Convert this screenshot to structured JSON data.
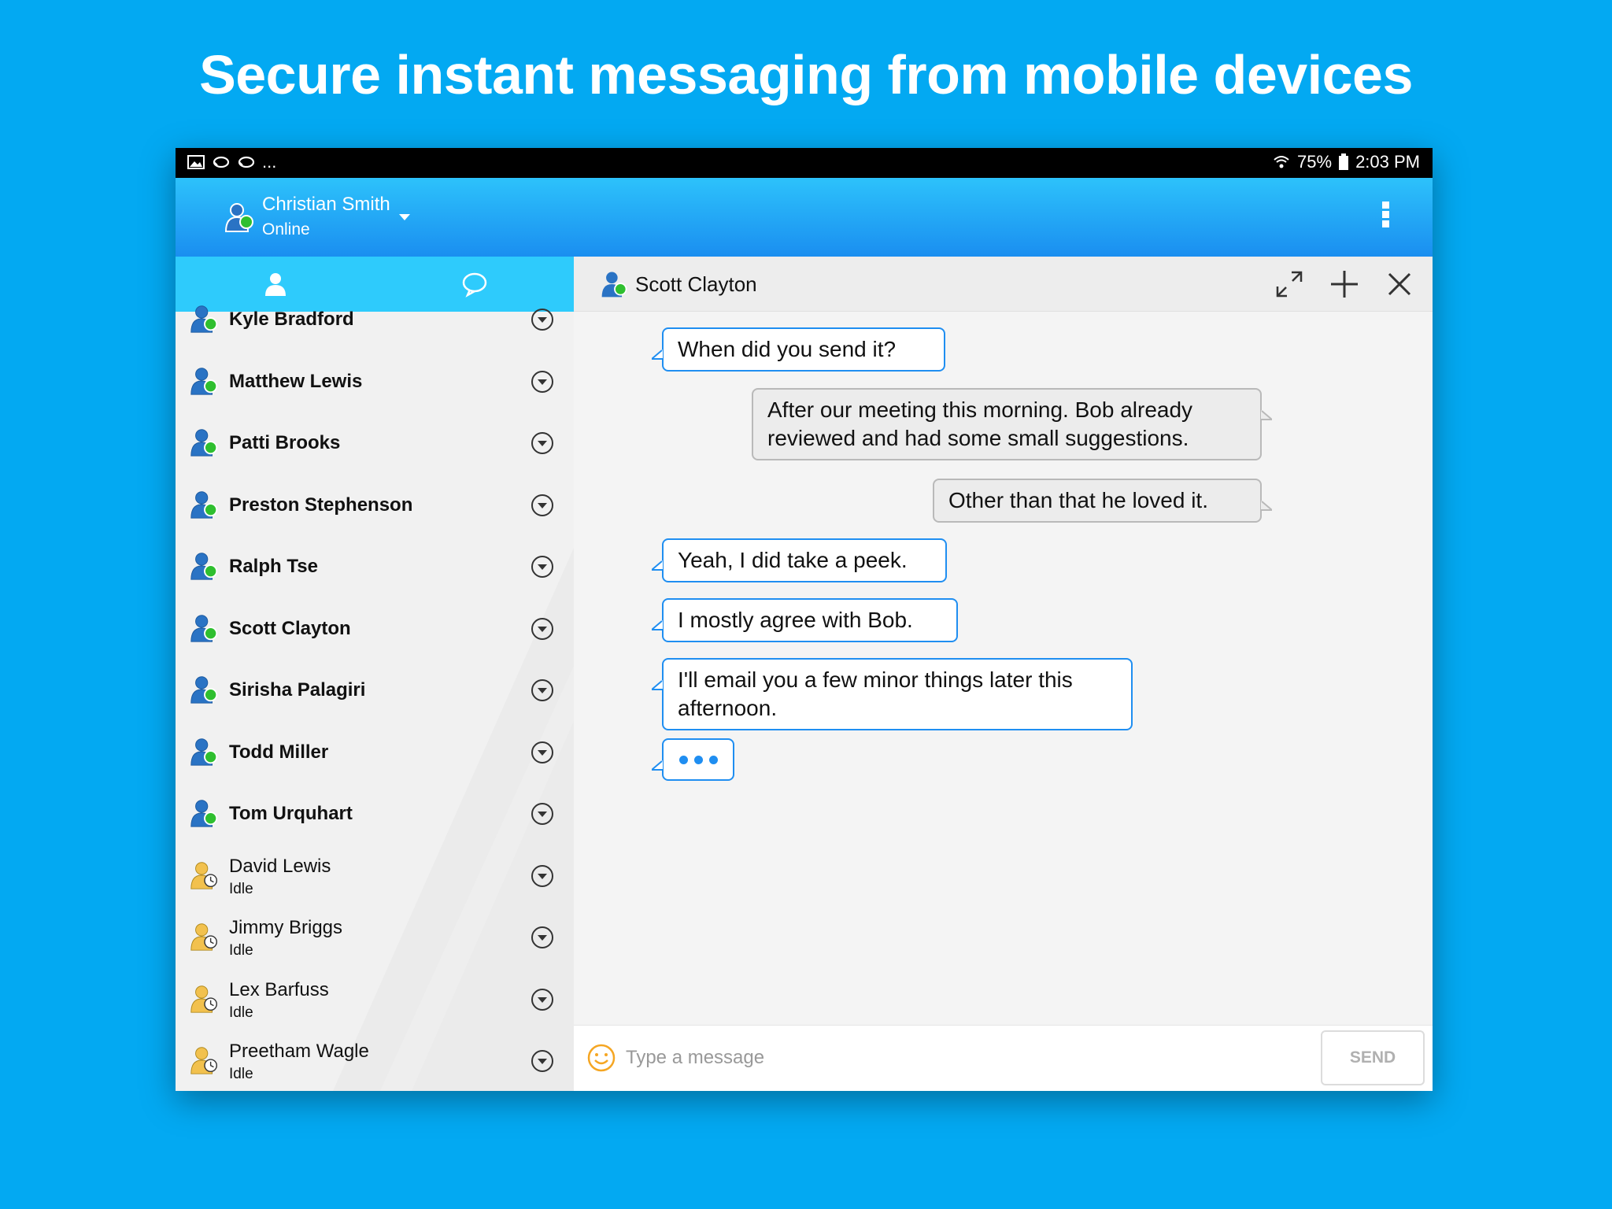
{
  "headline": "Secure instant messaging from mobile devices",
  "status_bar": {
    "battery": "75%",
    "time": "2:03 PM",
    "more_indicator": "...",
    "icons": [
      "image-icon",
      "sync-icon",
      "sync-icon",
      "wifi-icon",
      "battery-icon"
    ]
  },
  "app_bar": {
    "user_name": "Christian Smith",
    "user_status": "Online"
  },
  "tabs": [
    {
      "name": "contacts",
      "icon": "person-icon",
      "active": true
    },
    {
      "name": "chats",
      "icon": "chat-bubble-icon",
      "active": false
    }
  ],
  "contacts": [
    {
      "name": "Kyle Bradford",
      "status": "online",
      "sub": ""
    },
    {
      "name": "Matthew Lewis",
      "status": "online",
      "sub": ""
    },
    {
      "name": "Patti Brooks",
      "status": "online",
      "sub": ""
    },
    {
      "name": "Preston Stephenson",
      "status": "online",
      "sub": ""
    },
    {
      "name": "Ralph Tse",
      "status": "online",
      "sub": ""
    },
    {
      "name": "Scott Clayton",
      "status": "online",
      "sub": ""
    },
    {
      "name": "Sirisha Palagiri",
      "status": "online",
      "sub": ""
    },
    {
      "name": "Todd Miller",
      "status": "online",
      "sub": ""
    },
    {
      "name": "Tom Urquhart",
      "status": "online",
      "sub": ""
    },
    {
      "name": "David Lewis",
      "status": "idle",
      "sub": "Idle"
    },
    {
      "name": "Jimmy Briggs",
      "status": "idle",
      "sub": "Idle"
    },
    {
      "name": "Lex Barfuss",
      "status": "idle",
      "sub": "Idle"
    },
    {
      "name": "Preetham Wagle",
      "status": "idle",
      "sub": "Idle"
    }
  ],
  "chat": {
    "title": "Scott Clayton",
    "messages": [
      {
        "dir": "in",
        "text": "When did you send it?"
      },
      {
        "dir": "out",
        "text": "After our meeting this morning. Bob already reviewed and had some small suggestions."
      },
      {
        "dir": "out",
        "text": "Other than that he loved it."
      },
      {
        "dir": "in",
        "text": "Yeah, I did take a peek."
      },
      {
        "dir": "in",
        "text": "I mostly agree with Bob."
      },
      {
        "dir": "in",
        "text": "I'll email you a few minor things later this afternoon."
      }
    ],
    "typing_indicator": true
  },
  "composer": {
    "placeholder": "Type a message",
    "send_label": "SEND"
  },
  "colors": {
    "background": "#03a9f2",
    "app_bar": "#1a8ef0",
    "tab_bar": "#2ecbfc",
    "incoming_border": "#1f8ef1",
    "online": "#2fbf2f",
    "idle": "#f2c14e"
  }
}
